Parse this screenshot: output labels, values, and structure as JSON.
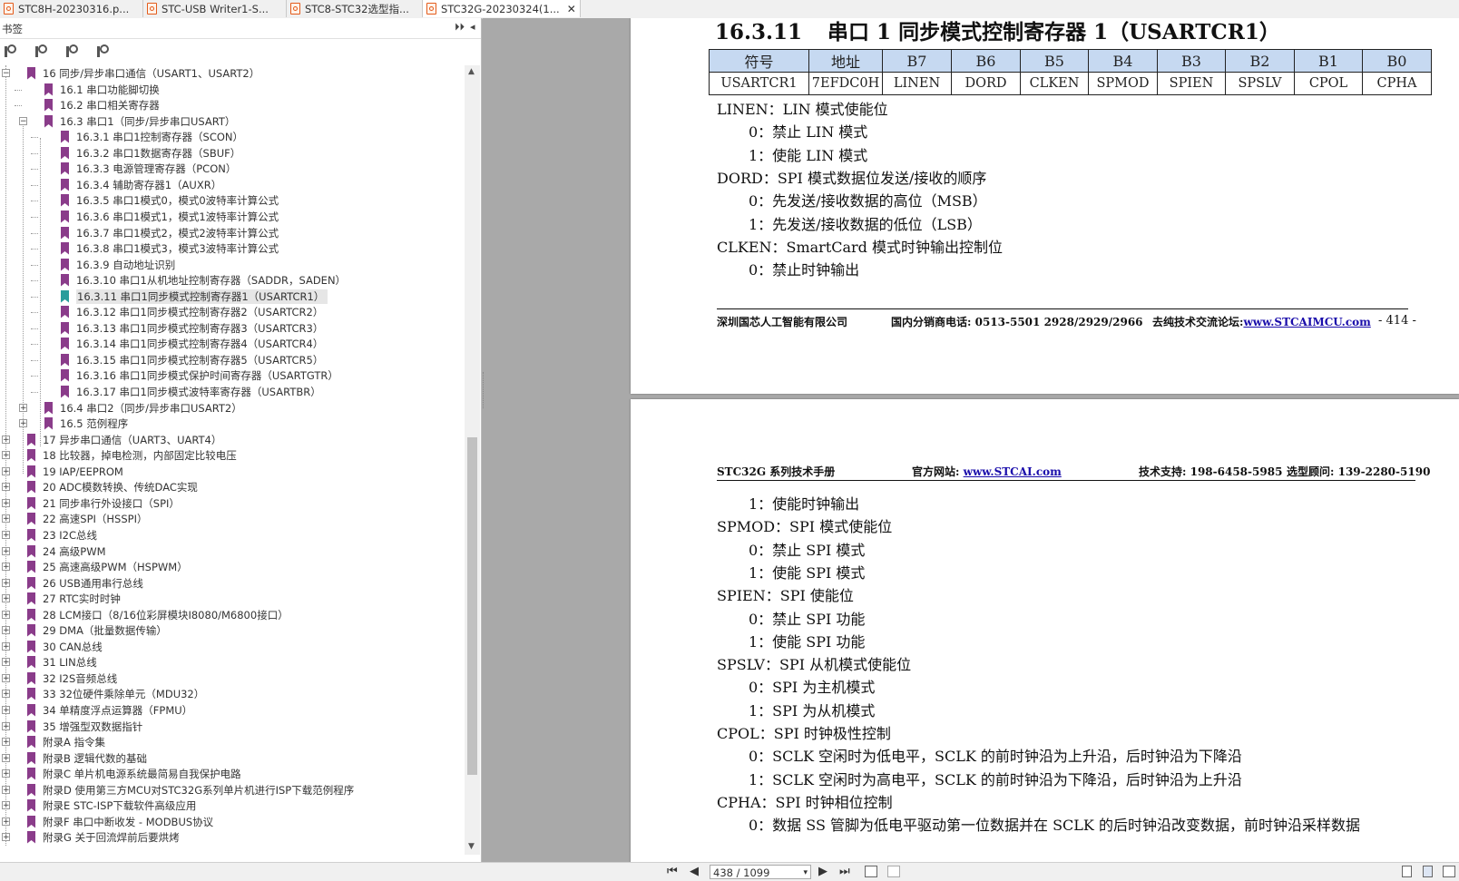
{
  "tabs": [
    {
      "label": "STC8H-20230316.p...",
      "active": false
    },
    {
      "label": "STC-USB Writer1-S...",
      "active": false
    },
    {
      "label": "STC8-STC32选型指...",
      "active": false
    },
    {
      "label": "STC32G-20230324(1...",
      "active": true
    }
  ],
  "tab_close": "✕",
  "panel": {
    "title": "书签",
    "expand_all": "⏵⏵",
    "collapse": "◂"
  },
  "toolbar_icons": [
    "bookmark-expand-icon",
    "bookmark-find-icon",
    "bookmark-add-icon",
    "bookmark-options-icon"
  ],
  "bookmarks": [
    {
      "label": "16 同步/异步串口通信（USART1、USART2）",
      "level": 0,
      "expander": "−"
    },
    {
      "label": "16.1 串口功能脚切换",
      "level": 1
    },
    {
      "label": "16.2 串口相关寄存器",
      "level": 1
    },
    {
      "label": "16.3 串口1（同步/异步串口USART）",
      "level": 1,
      "expander": "−"
    },
    {
      "label": "16.3.1 串口1控制寄存器（SCON）",
      "level": 2
    },
    {
      "label": "16.3.2 串口1数据寄存器（SBUF）",
      "level": 2
    },
    {
      "label": "16.3.3 电源管理寄存器（PCON）",
      "level": 2
    },
    {
      "label": "16.3.4 辅助寄存器1（AUXR）",
      "level": 2
    },
    {
      "label": "16.3.5 串口1模式0，模式0波特率计算公式",
      "level": 2
    },
    {
      "label": "16.3.6 串口1模式1，模式1波特率计算公式",
      "level": 2
    },
    {
      "label": "16.3.7 串口1模式2，模式2波特率计算公式",
      "level": 2
    },
    {
      "label": "16.3.8 串口1模式3，模式3波特率计算公式",
      "level": 2
    },
    {
      "label": "16.3.9 自动地址识别",
      "level": 2
    },
    {
      "label": "16.3.10 串口1从机地址控制寄存器（SADDR，SADEN）",
      "level": 2
    },
    {
      "label": "16.3.11 串口1同步模式控制寄存器1（USARTCR1）",
      "level": 2,
      "selected": true
    },
    {
      "label": "16.3.12 串口1同步模式控制寄存器2（USARTCR2）",
      "level": 2
    },
    {
      "label": "16.3.13 串口1同步模式控制寄存器3（USARTCR3）",
      "level": 2
    },
    {
      "label": "16.3.14 串口1同步模式控制寄存器4（USARTCR4）",
      "level": 2
    },
    {
      "label": "16.3.15 串口1同步模式控制寄存器5（USARTCR5）",
      "level": 2
    },
    {
      "label": "16.3.16 串口1同步模式保护时间寄存器（USARTGTR）",
      "level": 2
    },
    {
      "label": "16.3.17 串口1同步模式波特率寄存器（USARTBR）",
      "level": 2
    },
    {
      "label": "16.4 串口2（同步/异步串口USART2）",
      "level": 1,
      "expander": "+"
    },
    {
      "label": "16.5 范例程序",
      "level": 1,
      "expander": "+"
    },
    {
      "label": "17 异步串口通信（UART3、UART4）",
      "level": 0,
      "expander": "+"
    },
    {
      "label": "18 比较器，掉电检测，内部固定比较电压",
      "level": 0,
      "expander": "+"
    },
    {
      "label": "19 IAP/EEPROM",
      "level": 0,
      "expander": "+"
    },
    {
      "label": "20 ADC模数转换、传统DAC实现",
      "level": 0,
      "expander": "+"
    },
    {
      "label": "21 同步串行外设接口（SPI）",
      "level": 0,
      "expander": "+"
    },
    {
      "label": "22 高速SPI（HSSPI）",
      "level": 0,
      "expander": "+"
    },
    {
      "label": "23 I2C总线",
      "level": 0,
      "expander": "+"
    },
    {
      "label": "24 高级PWM",
      "level": 0,
      "expander": "+"
    },
    {
      "label": "25 高速高级PWM（HSPWM）",
      "level": 0,
      "expander": "+"
    },
    {
      "label": "26 USB通用串行总线",
      "level": 0,
      "expander": "+"
    },
    {
      "label": "27 RTC实时时钟",
      "level": 0,
      "expander": "+"
    },
    {
      "label": "28 LCM接口（8/16位彩屏模块I8080/M6800接口）",
      "level": 0,
      "expander": "+"
    },
    {
      "label": "29 DMA（批量数据传输）",
      "level": 0,
      "expander": "+"
    },
    {
      "label": "30 CAN总线",
      "level": 0,
      "expander": "+"
    },
    {
      "label": "31 LIN总线",
      "level": 0,
      "expander": "+"
    },
    {
      "label": "32 I2S音频总线",
      "level": 0,
      "expander": "+"
    },
    {
      "label": "33 32位硬件乘除单元（MDU32）",
      "level": 0,
      "expander": "+"
    },
    {
      "label": "34 单精度浮点运算器（FPMU）",
      "level": 0,
      "expander": "+"
    },
    {
      "label": "35 增强型双数据指针",
      "level": 0,
      "expander": "+"
    },
    {
      "label": "附录A 指令集",
      "level": 0,
      "expander": "+"
    },
    {
      "label": "附录B 逻辑代数的基础",
      "level": 0,
      "expander": "+"
    },
    {
      "label": "附录C 单片机电源系统最简易自我保护电路",
      "level": 0,
      "expander": "+"
    },
    {
      "label": "附录D 使用第三方MCU对STC32G系列单片机进行ISP下载范例程序",
      "level": 0,
      "expander": "+"
    },
    {
      "label": "附录E STC-ISP下载软件高级应用",
      "level": 0,
      "expander": "+"
    },
    {
      "label": "附录F 串口中断收发 - MODBUS协议",
      "level": 0,
      "expander": "+"
    },
    {
      "label": "附录G 关于回流焊前后要烘烤",
      "level": 0,
      "expander": "+"
    }
  ],
  "page1": {
    "section_number": "16.3.11",
    "section_title": "串口 1 同步模式控制寄存器 1（USARTCR1）",
    "table_header": [
      "符号",
      "地址",
      "B7",
      "B6",
      "B5",
      "B4",
      "B3",
      "B2",
      "B1",
      "B0"
    ],
    "table_row": [
      "USARTCR1",
      "7EFDC0H",
      "LINEN",
      "DORD",
      "CLKEN",
      "SPMOD",
      "SPIEN",
      "SPSLV",
      "CPOL",
      "CPHA"
    ],
    "lines": [
      {
        "text": "LINEN：LIN 模式使能位",
        "indent": false
      },
      {
        "text": "0：禁止 LIN 模式",
        "indent": true
      },
      {
        "text": "1：使能 LIN 模式",
        "indent": true
      },
      {
        "text": "DORD：SPI 模式数据位发送/接收的顺序",
        "indent": false
      },
      {
        "text": "0：先发送/接收数据的高位（MSB）",
        "indent": true
      },
      {
        "text": "1：先发送/接收数据的低位（LSB）",
        "indent": true
      },
      {
        "text": "CLKEN：SmartCard 模式时钟输出控制位",
        "indent": false
      },
      {
        "text": "0：禁止时钟输出",
        "indent": true
      }
    ],
    "footer": {
      "company": "深圳国芯人工智能有限公司",
      "phone": "国内分销商电话: 0513-5501 2928/2929/2966",
      "forum_label": "去纯技术交流论坛:",
      "forum_url": "www.STCAIMCU.com",
      "page_no": "- 414 -"
    }
  },
  "page2": {
    "header": {
      "manual": "STC32G 系列技术手册",
      "site_label": "官方网站: ",
      "site_url": "www.STCAI.com",
      "support": "技术支持: 198-6458-5985",
      "sales": "选型顾问: 139-2280-5190"
    },
    "lines": [
      {
        "text": "1：使能时钟输出",
        "indent": true
      },
      {
        "text": "SPMOD：SPI 模式使能位",
        "indent": false
      },
      {
        "text": "0：禁止 SPI 模式",
        "indent": true
      },
      {
        "text": "1：使能 SPI 模式",
        "indent": true
      },
      {
        "text": "SPIEN：SPI 使能位",
        "indent": false
      },
      {
        "text": "0：禁止 SPI 功能",
        "indent": true
      },
      {
        "text": "1：使能 SPI 功能",
        "indent": true
      },
      {
        "text": "SPSLV：SPI 从机模式使能位",
        "indent": false
      },
      {
        "text": "0：SPI 为主机模式",
        "indent": true
      },
      {
        "text": "1：SPI 为从机模式",
        "indent": true
      },
      {
        "text": "CPOL：SPI 时钟极性控制",
        "indent": false
      },
      {
        "text": "0：SCLK 空闲时为低电平，SCLK 的前时钟沿为上升沿，后时钟沿为下降沿",
        "indent": true
      },
      {
        "text": "1：SCLK 空闲时为高电平，SCLK 的前时钟沿为下降沿，后时钟沿为上升沿",
        "indent": true
      },
      {
        "text": "CPHA：SPI 时钟相位控制",
        "indent": false
      },
      {
        "text": "0：数据 SS 管脚为低电平驱动第一位数据并在 SCLK 的后时钟沿改变数据，前时钟沿采样数据",
        "indent": true
      }
    ]
  },
  "statusbar": {
    "first": "⏮",
    "prev": "◀",
    "next": "▶",
    "last": "⏭",
    "page_indicator": "438 / 1099",
    "dropdown": "▾"
  }
}
